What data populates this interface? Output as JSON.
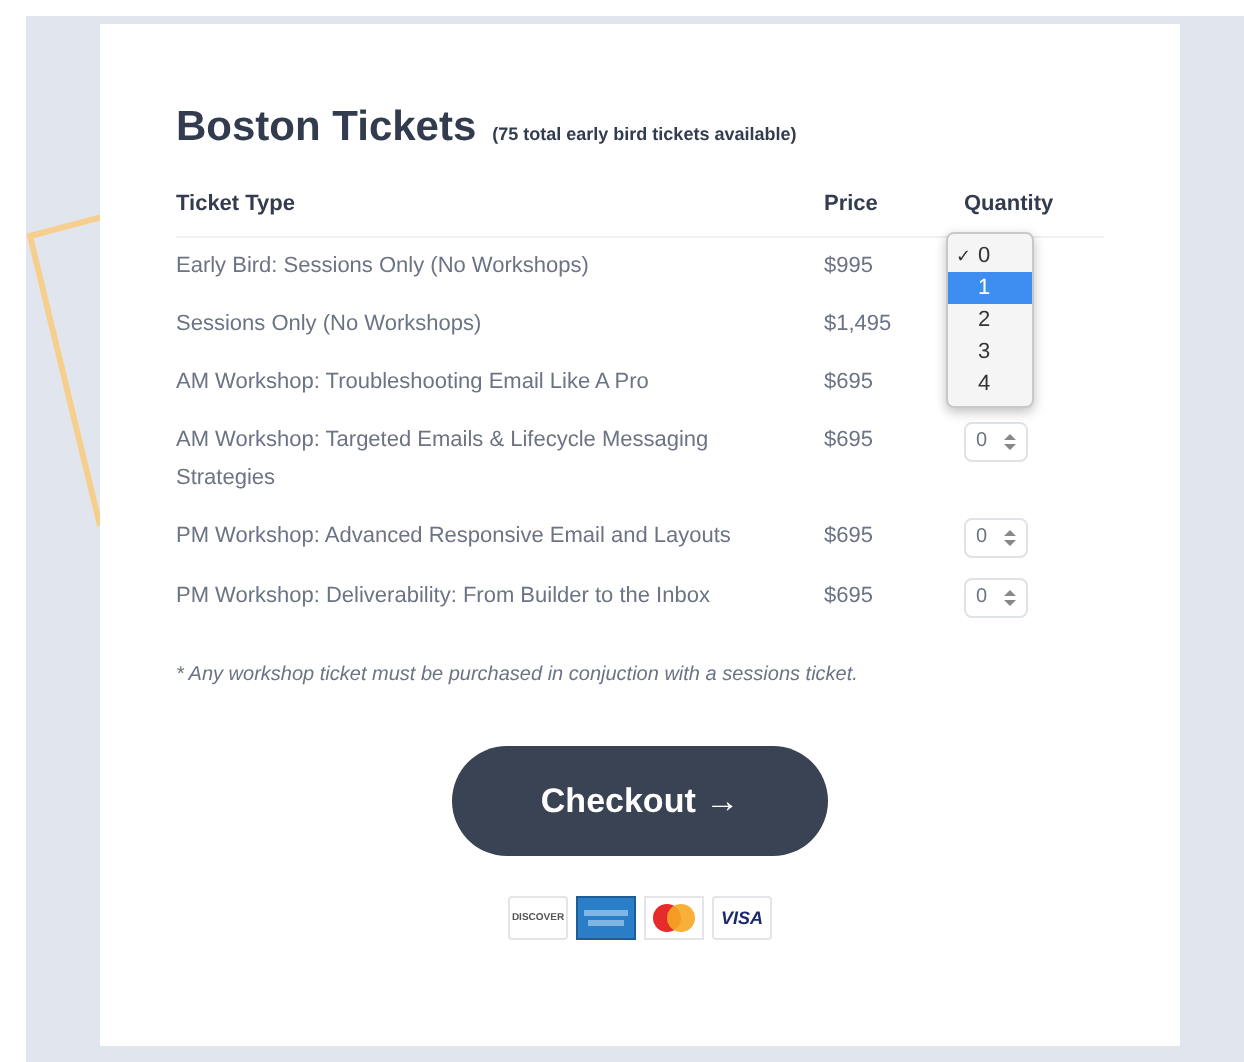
{
  "heading": {
    "title": "Boston Tickets",
    "subtitle": "(75 total early bird tickets available)"
  },
  "columns": [
    "Ticket Type",
    "Price",
    "Quantity"
  ],
  "rows": [
    {
      "type": "Early Bird: Sessions Only (No Workshops)",
      "price": "$995"
    },
    {
      "type": "Sessions Only (No Workshops)",
      "price": "$1,495"
    },
    {
      "type": "AM Workshop: Troubleshooting Email Like A Pro",
      "price": "$695"
    },
    {
      "type": "AM Workshop: Targeted Emails & Lifecycle Messaging Strategies",
      "price": "$695",
      "quantity": "0"
    },
    {
      "type": "PM Workshop: Advanced Responsive Email and Layouts",
      "price": "$695",
      "quantity": "0"
    },
    {
      "type": "PM Workshop: Deliverability: From Builder to the Inbox",
      "price": "$695",
      "quantity": "0"
    }
  ],
  "dropdown": {
    "check": "✓",
    "options": [
      {
        "label": "0",
        "checked": true,
        "highlighted": false
      },
      {
        "label": "1",
        "checked": false,
        "highlighted": true
      },
      {
        "label": "2",
        "checked": false,
        "highlighted": false
      },
      {
        "label": "3",
        "checked": false,
        "highlighted": false
      },
      {
        "label": "4",
        "checked": false,
        "highlighted": false
      }
    ]
  },
  "note": "* Any workshop ticket must be purchased in conjuction with a sessions ticket.",
  "checkout": "Checkout →",
  "payment_cards": [
    {
      "kind": "discover",
      "label": "DISCOVER"
    },
    {
      "kind": "amex"
    },
    {
      "kind": "mastercard"
    },
    {
      "kind": "visa",
      "label": "VISA"
    }
  ]
}
